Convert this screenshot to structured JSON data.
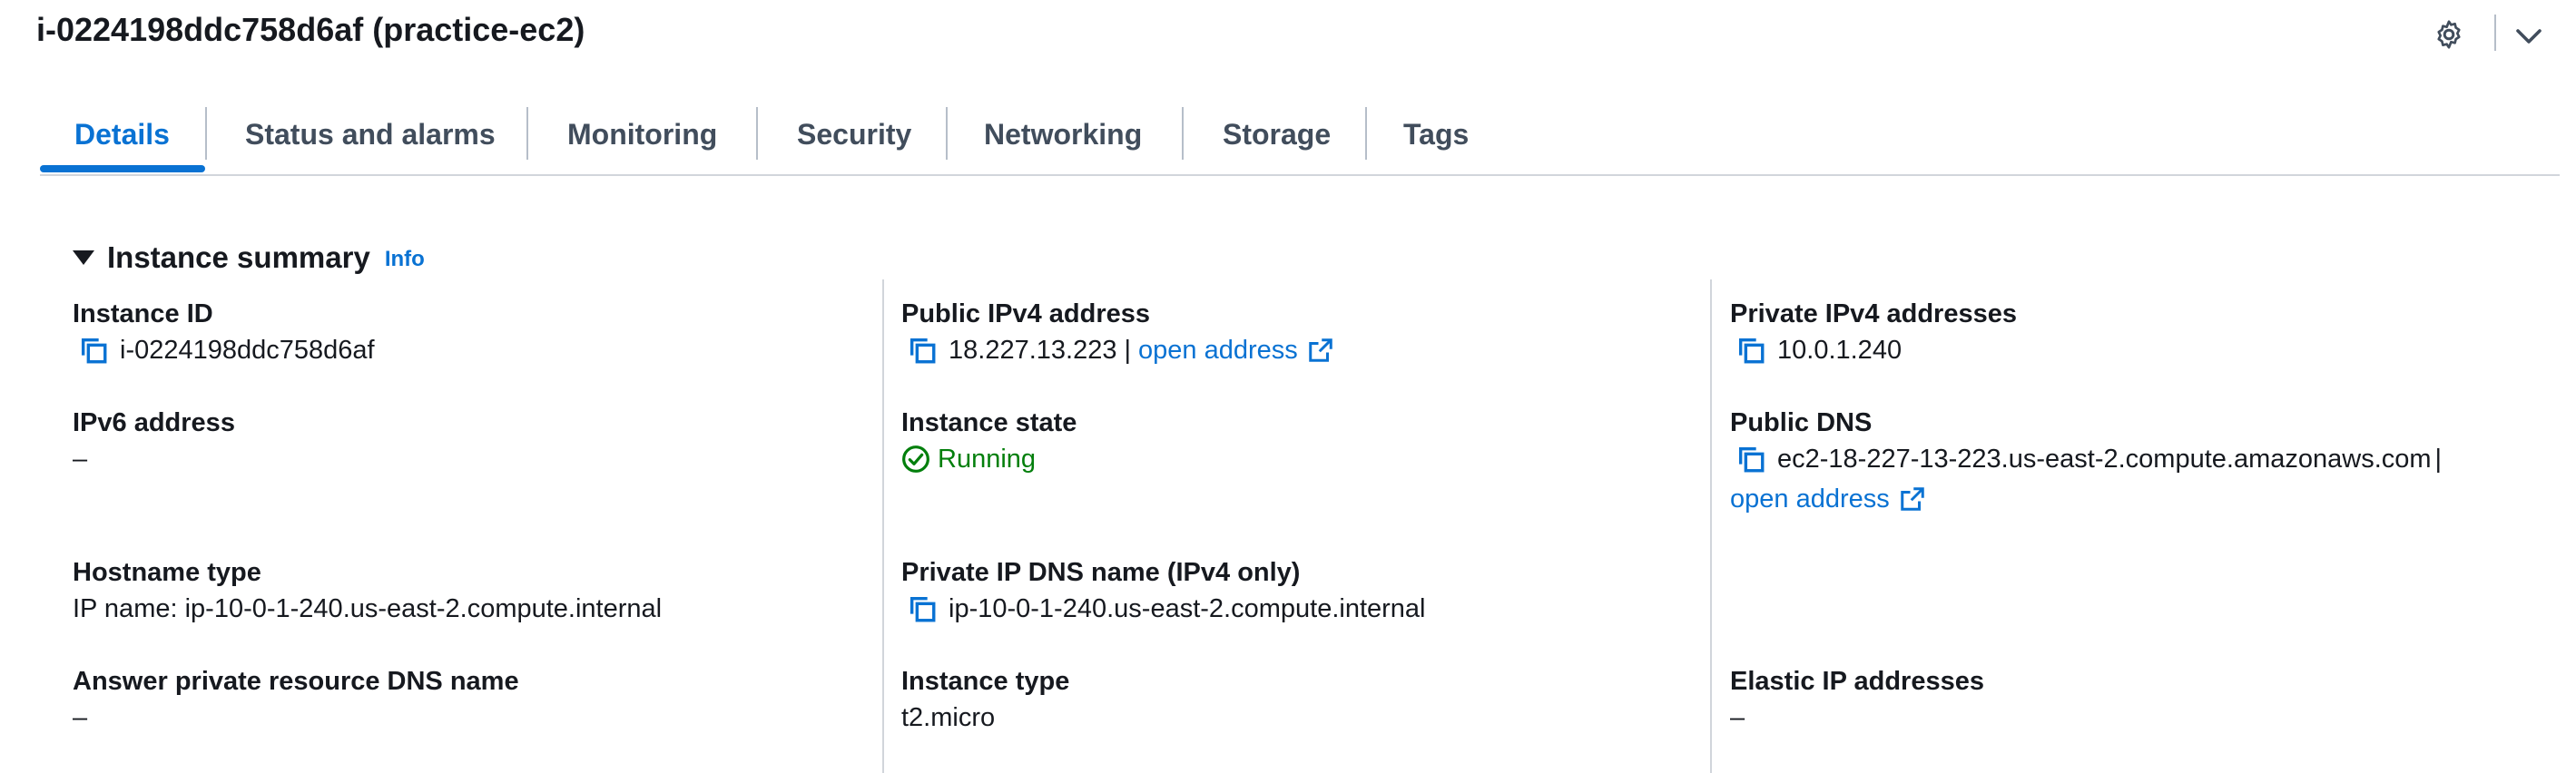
{
  "header": {
    "title": "i-0224198ddc758d6af (practice-ec2)",
    "settings_icon": "gear-icon",
    "collapse_icon": "chevron-down-icon"
  },
  "tabs": [
    {
      "label": "Details",
      "active": true
    },
    {
      "label": "Status and alarms"
    },
    {
      "label": "Monitoring"
    },
    {
      "label": "Security"
    },
    {
      "label": "Networking"
    },
    {
      "label": "Storage"
    },
    {
      "label": "Tags"
    }
  ],
  "summary": {
    "title": "Instance summary",
    "info_label": "Info",
    "fields": {
      "instance_id": {
        "label": "Instance ID",
        "value": "i-0224198ddc758d6af"
      },
      "public_ipv4": {
        "label": "Public IPv4 address",
        "value": "18.227.13.223",
        "separator": "|",
        "link": "open address"
      },
      "private_ipv4": {
        "label": "Private IPv4 addresses",
        "value": "10.0.1.240"
      },
      "ipv6": {
        "label": "IPv6 address",
        "value": "–"
      },
      "instance_state": {
        "label": "Instance state",
        "value": "Running"
      },
      "public_dns": {
        "label": "Public DNS",
        "value": "ec2-18-227-13-223.us-east-2.compute.amazonaws.com",
        "separator": "|",
        "link": "open address"
      },
      "hostname_type": {
        "label": "Hostname type",
        "value": "IP name: ip-10-0-1-240.us-east-2.compute.internal"
      },
      "private_ip_dns": {
        "label": "Private IP DNS name (IPv4 only)",
        "value": "ip-10-0-1-240.us-east-2.compute.internal"
      },
      "answer_private_dns": {
        "label": "Answer private resource DNS name",
        "value": "–"
      },
      "instance_type": {
        "label": "Instance type",
        "value": "t2.micro"
      },
      "elastic_ip": {
        "label": "Elastic IP addresses",
        "value": "–"
      }
    }
  },
  "colors": {
    "accent": "#0972d3",
    "success": "#037f0c",
    "text": "#16191f",
    "divider": "#d1d5db"
  }
}
